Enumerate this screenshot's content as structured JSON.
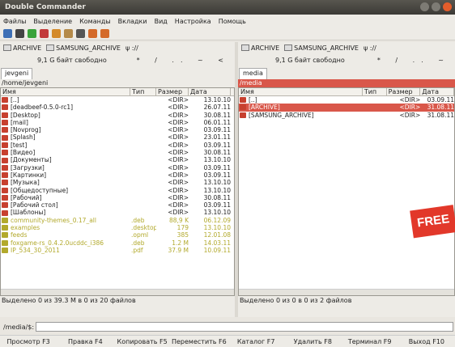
{
  "window": {
    "title": "Double Commander"
  },
  "menu": [
    "Файлы",
    "Выделение",
    "Команды",
    "Вкладки",
    "Вид",
    "Настройка",
    "Помощь"
  ],
  "toolbar_icons": [
    {
      "name": "refresh-icon",
      "color": "#3d6fb5"
    },
    {
      "name": "copy-icon",
      "color": "#444"
    },
    {
      "name": "add-icon",
      "color": "#3aa33a"
    },
    {
      "name": "minus-icon",
      "color": "#c23a3a"
    },
    {
      "name": "home-icon",
      "color": "#d48a2a"
    },
    {
      "name": "folder-icon",
      "color": "#b48a4a"
    },
    {
      "name": "search-icon",
      "color": "#555"
    },
    {
      "name": "back-icon",
      "color": "#d46a2a"
    },
    {
      "name": "forward-icon",
      "color": "#d46a2a"
    }
  ],
  "left": {
    "drives": [
      "ARCHIVE",
      "SAMSUNG_ARCHIVE",
      "ψ ://"
    ],
    "free": "9,1 G байт свободно",
    "nav": "* / .. ~ <",
    "tab": "jevgeni",
    "path": "/home/jevgeni",
    "columns": [
      "Имя",
      "Тип",
      "Размер",
      "Дата"
    ],
    "rows": [
      {
        "name": "[..]",
        "type": "",
        "size": "<DIR>",
        "date": "13.10.10",
        "kind": "up"
      },
      {
        "name": "[deadbeef-0.5.0-rc1]",
        "type": "",
        "size": "<DIR>",
        "date": "26.07.11",
        "kind": "dir"
      },
      {
        "name": "[Desktop]",
        "type": "",
        "size": "<DIR>",
        "date": "30.08.11",
        "kind": "dir"
      },
      {
        "name": "[mail]",
        "type": "",
        "size": "<DIR>",
        "date": "06.01.11",
        "kind": "dir"
      },
      {
        "name": "[Novprog]",
        "type": "",
        "size": "<DIR>",
        "date": "03.09.11",
        "kind": "dir"
      },
      {
        "name": "[Splash]",
        "type": "",
        "size": "<DIR>",
        "date": "23.01.11",
        "kind": "dir"
      },
      {
        "name": "[test]",
        "type": "",
        "size": "<DIR>",
        "date": "03.09.11",
        "kind": "dir"
      },
      {
        "name": "[Видео]",
        "type": "",
        "size": "<DIR>",
        "date": "30.08.11",
        "kind": "dir"
      },
      {
        "name": "[Документы]",
        "type": "",
        "size": "<DIR>",
        "date": "13.10.10",
        "kind": "dir"
      },
      {
        "name": "[Загрузки]",
        "type": "",
        "size": "<DIR>",
        "date": "03.09.11",
        "kind": "dir"
      },
      {
        "name": "[Картинки]",
        "type": "",
        "size": "<DIR>",
        "date": "03.09.11",
        "kind": "dir"
      },
      {
        "name": "[Музыка]",
        "type": "",
        "size": "<DIR>",
        "date": "13.10.10",
        "kind": "dir"
      },
      {
        "name": "[Общедоступные]",
        "type": "",
        "size": "<DIR>",
        "date": "13.10.10",
        "kind": "dir"
      },
      {
        "name": "[Рабочий]",
        "type": "",
        "size": "<DIR>",
        "date": "30.08.11",
        "kind": "dir"
      },
      {
        "name": "[Рабочий стол]",
        "type": "",
        "size": "<DIR>",
        "date": "03.09.11",
        "kind": "dir"
      },
      {
        "name": "[Шаблоны]",
        "type": "",
        "size": "<DIR>",
        "date": "13.10.10",
        "kind": "dir"
      },
      {
        "name": "community-themes_0.17_all",
        "type": ".deb",
        "size": "88,9 K",
        "date": "06.12.09",
        "kind": "file"
      },
      {
        "name": "examples",
        "type": ".desktop",
        "size": "179",
        "date": "13.10.10",
        "kind": "file"
      },
      {
        "name": "feeds",
        "type": ".opml",
        "size": "385",
        "date": "12.01.08",
        "kind": "file"
      },
      {
        "name": "foxgame-rs_0.4.2.0ucddc_i386",
        "type": ".deb",
        "size": "1.2 M",
        "date": "14.03.11",
        "kind": "file"
      },
      {
        "name": "IP_534_30_2011",
        "type": ".pdf",
        "size": "37.9 M",
        "date": "10.09.11",
        "kind": "file"
      }
    ],
    "status": "Выделено 0 из 39.3 M в 0 из 20 файлов"
  },
  "right": {
    "drives": [
      "ARCHIVE",
      "SAMSUNG_ARCHIVE",
      "ψ ://"
    ],
    "free": "9,1 G байт свободно",
    "nav": "* / .. ~",
    "tab": "media",
    "path": "/media",
    "columns": [
      "Имя",
      "Тип",
      "Размер",
      "Дата"
    ],
    "rows": [
      {
        "name": "[..]",
        "type": "",
        "size": "<DIR>",
        "date": "03.09.11",
        "kind": "up"
      },
      {
        "name": "[ARCHIVE]",
        "type": "",
        "size": "<DIR>",
        "date": "31.08.11",
        "kind": "sel"
      },
      {
        "name": "[SAMSUNG_ARCHIVE]",
        "type": "",
        "size": "<DIR>",
        "date": "31.08.11",
        "kind": "dir"
      }
    ],
    "status": "Выделено 0 из 0 в 0 из 2 файлов"
  },
  "cmdline": {
    "label": "/media/$:",
    "value": ""
  },
  "fkeys": [
    "Просмотр F3",
    "Правка F4",
    "Копировать F5",
    "Переместить F6",
    "Каталог F7",
    "Удалить F8",
    "Терминал F9",
    "Выход F10"
  ],
  "badge": "FREE",
  "colors": {
    "accent": "#d9574a",
    "file_text": "#b2a92c",
    "folder": "#c7402f"
  }
}
